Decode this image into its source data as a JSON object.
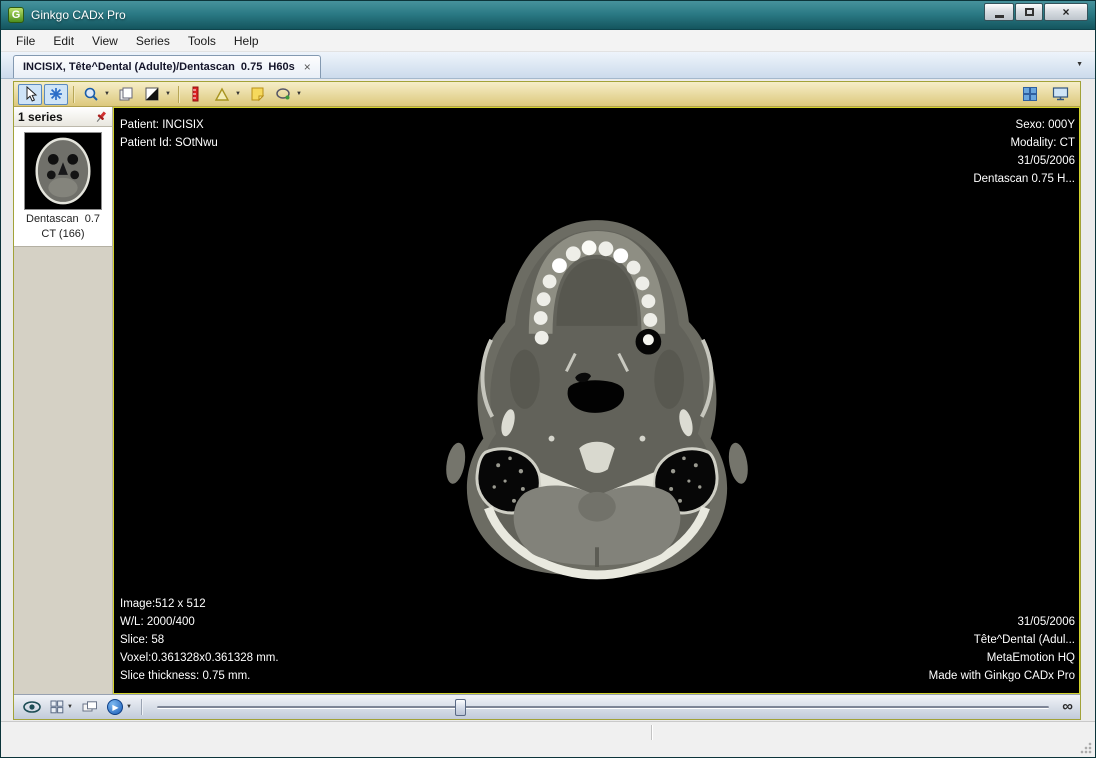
{
  "glyphs": {
    "dropdown": "▼",
    "close": "×",
    "infinity": "∞",
    "play": "▶"
  },
  "window": {
    "title": "Ginkgo CADx Pro",
    "app_icon_letter": "G"
  },
  "menu": {
    "items": [
      "File",
      "Edit",
      "View",
      "Series",
      "Tools",
      "Help"
    ]
  },
  "tab": {
    "title": "INCISIX, Tête^Dental (Adulte)/Dentascan  0.75  H60s"
  },
  "sidebar": {
    "header": "1 series",
    "series_name": "Dentascan  0.7",
    "series_info": "CT (166)"
  },
  "viewer": {
    "top_left": [
      "Patient: INCISIX",
      "Patient Id: SOtNwu"
    ],
    "top_right": [
      "Sexo: 000Y",
      "Modality: CT",
      "31/05/2006",
      "Dentascan 0.75 H..."
    ],
    "bottom_left": [
      "Image:512 x 512",
      "W/L: 2000/400",
      "Slice: 58",
      "Voxel:0.361328x0.361328 mm.",
      "Slice thickness: 0.75 mm."
    ],
    "bottom_right": [
      "31/05/2006",
      "Tête^Dental (Adul...",
      "MetaEmotion HQ",
      "Made with Ginkgo CADx Pro"
    ]
  },
  "bottom_bar": {
    "slider_percent": 34
  }
}
